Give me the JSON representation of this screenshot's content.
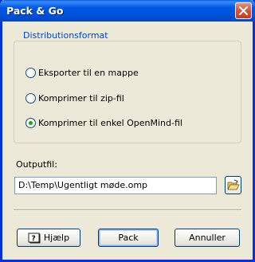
{
  "window": {
    "title": "Pack & Go"
  },
  "distribution": {
    "legend": "Distributionsformat",
    "options": [
      {
        "label": "Eksporter til en mappe",
        "checked": false
      },
      {
        "label": "Komprimer til zip-fil",
        "checked": false
      },
      {
        "label": "Komprimer til enkel OpenMind-fil",
        "checked": true
      }
    ]
  },
  "output": {
    "label": "Outputfil:",
    "value": "D:\\Temp\\Ugentligt møde.omp"
  },
  "buttons": {
    "help": "Hjælp",
    "pack": "Pack",
    "cancel": "Annuller"
  },
  "icons": {
    "close": "close-icon",
    "browse": "folder-open-icon",
    "help": "help-book-icon"
  },
  "colors": {
    "titlebar": "#0058e6",
    "legend": "#0046d5",
    "radio_dot": "#21a121",
    "close": "#d4543a"
  }
}
